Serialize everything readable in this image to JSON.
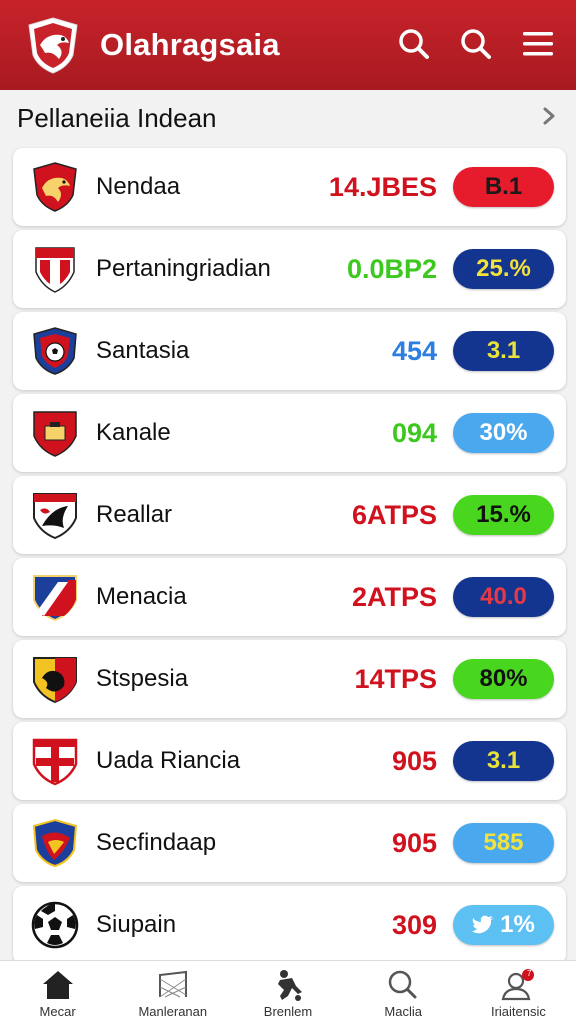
{
  "header": {
    "title": "Olahragsaia",
    "logo_icon": "team-crest-logo",
    "icons": [
      "search-icon",
      "search-icon",
      "menu-icon"
    ],
    "bar_color": "#c8232b"
  },
  "section": {
    "title": "Pellaneiia Indean",
    "chevron_icon": "chevron-right-icon"
  },
  "rows": [
    {
      "name": "Nendaa",
      "stat": "14.JBES",
      "stat_color": "#d0121f",
      "badge": "B.1",
      "badge_bg": "#e61b2b",
      "badge_fg": "#1a1a1a"
    },
    {
      "name": "Pertaningriadian",
      "stat": "0.0BP2",
      "stat_color": "#3cc81e",
      "badge": "25.%",
      "badge_bg": "#13348f",
      "badge_fg": "#f3e23a"
    },
    {
      "name": "Santasia",
      "stat": "454",
      "stat_color": "#2d7ee0",
      "badge": "3.1",
      "badge_bg": "#13348f",
      "badge_fg": "#e8e23a"
    },
    {
      "name": "Kanale",
      "stat": "094",
      "stat_color": "#3cc81e",
      "badge": "30%",
      "badge_bg": "#4aa8ee",
      "badge_fg": "#ffffff"
    },
    {
      "name": "Reallar",
      "stat": "6ATPS",
      "stat_color": "#d0121f",
      "badge": "15.%",
      "badge_bg": "#49d61e",
      "badge_fg": "#111111"
    },
    {
      "name": "Menacia",
      "stat": "2ATPS",
      "stat_color": "#d0121f",
      "badge": "40.0",
      "badge_bg": "#13348f",
      "badge_fg": "#e43a46"
    },
    {
      "name": "Stspesia",
      "stat": "14TPS",
      "stat_color": "#d0121f",
      "badge": "80%",
      "badge_bg": "#49d61e",
      "badge_fg": "#111111"
    },
    {
      "name": "Uada Riancia",
      "stat": "905",
      "stat_color": "#d0121f",
      "badge": "3.1",
      "badge_bg": "#13348f",
      "badge_fg": "#e8e23a"
    },
    {
      "name": "Secfindaap",
      "stat": "905",
      "stat_color": "#d0121f",
      "badge": "585",
      "badge_bg": "#4aa8ee",
      "badge_fg": "#f3e23a"
    },
    {
      "name": "Siupain",
      "stat": "309",
      "stat_color": "#d0121f",
      "badge": "1%",
      "badge_bg": "#5cc0f2",
      "badge_fg": "#ffffff",
      "badge_icon": "bird-icon"
    }
  ],
  "crests": [
    "crest-bird-icon",
    "crest-red-white-icon",
    "crest-ball-icon",
    "crest-shield-icon",
    "crest-swirl-icon",
    "crest-diagonal-icon",
    "crest-lion-icon",
    "crest-cross-icon",
    "crest-wing-icon",
    "soccer-ball-icon"
  ],
  "nav": [
    {
      "label": "Mecar",
      "icon": "home-icon"
    },
    {
      "label": "Manleranan",
      "icon": "goal-net-icon"
    },
    {
      "label": "Brenlem",
      "icon": "player-kick-icon"
    },
    {
      "label": "Maclia",
      "icon": "search-icon"
    },
    {
      "label": "Iriaitensic",
      "icon": "profile-notification-icon",
      "badge": "7"
    }
  ]
}
